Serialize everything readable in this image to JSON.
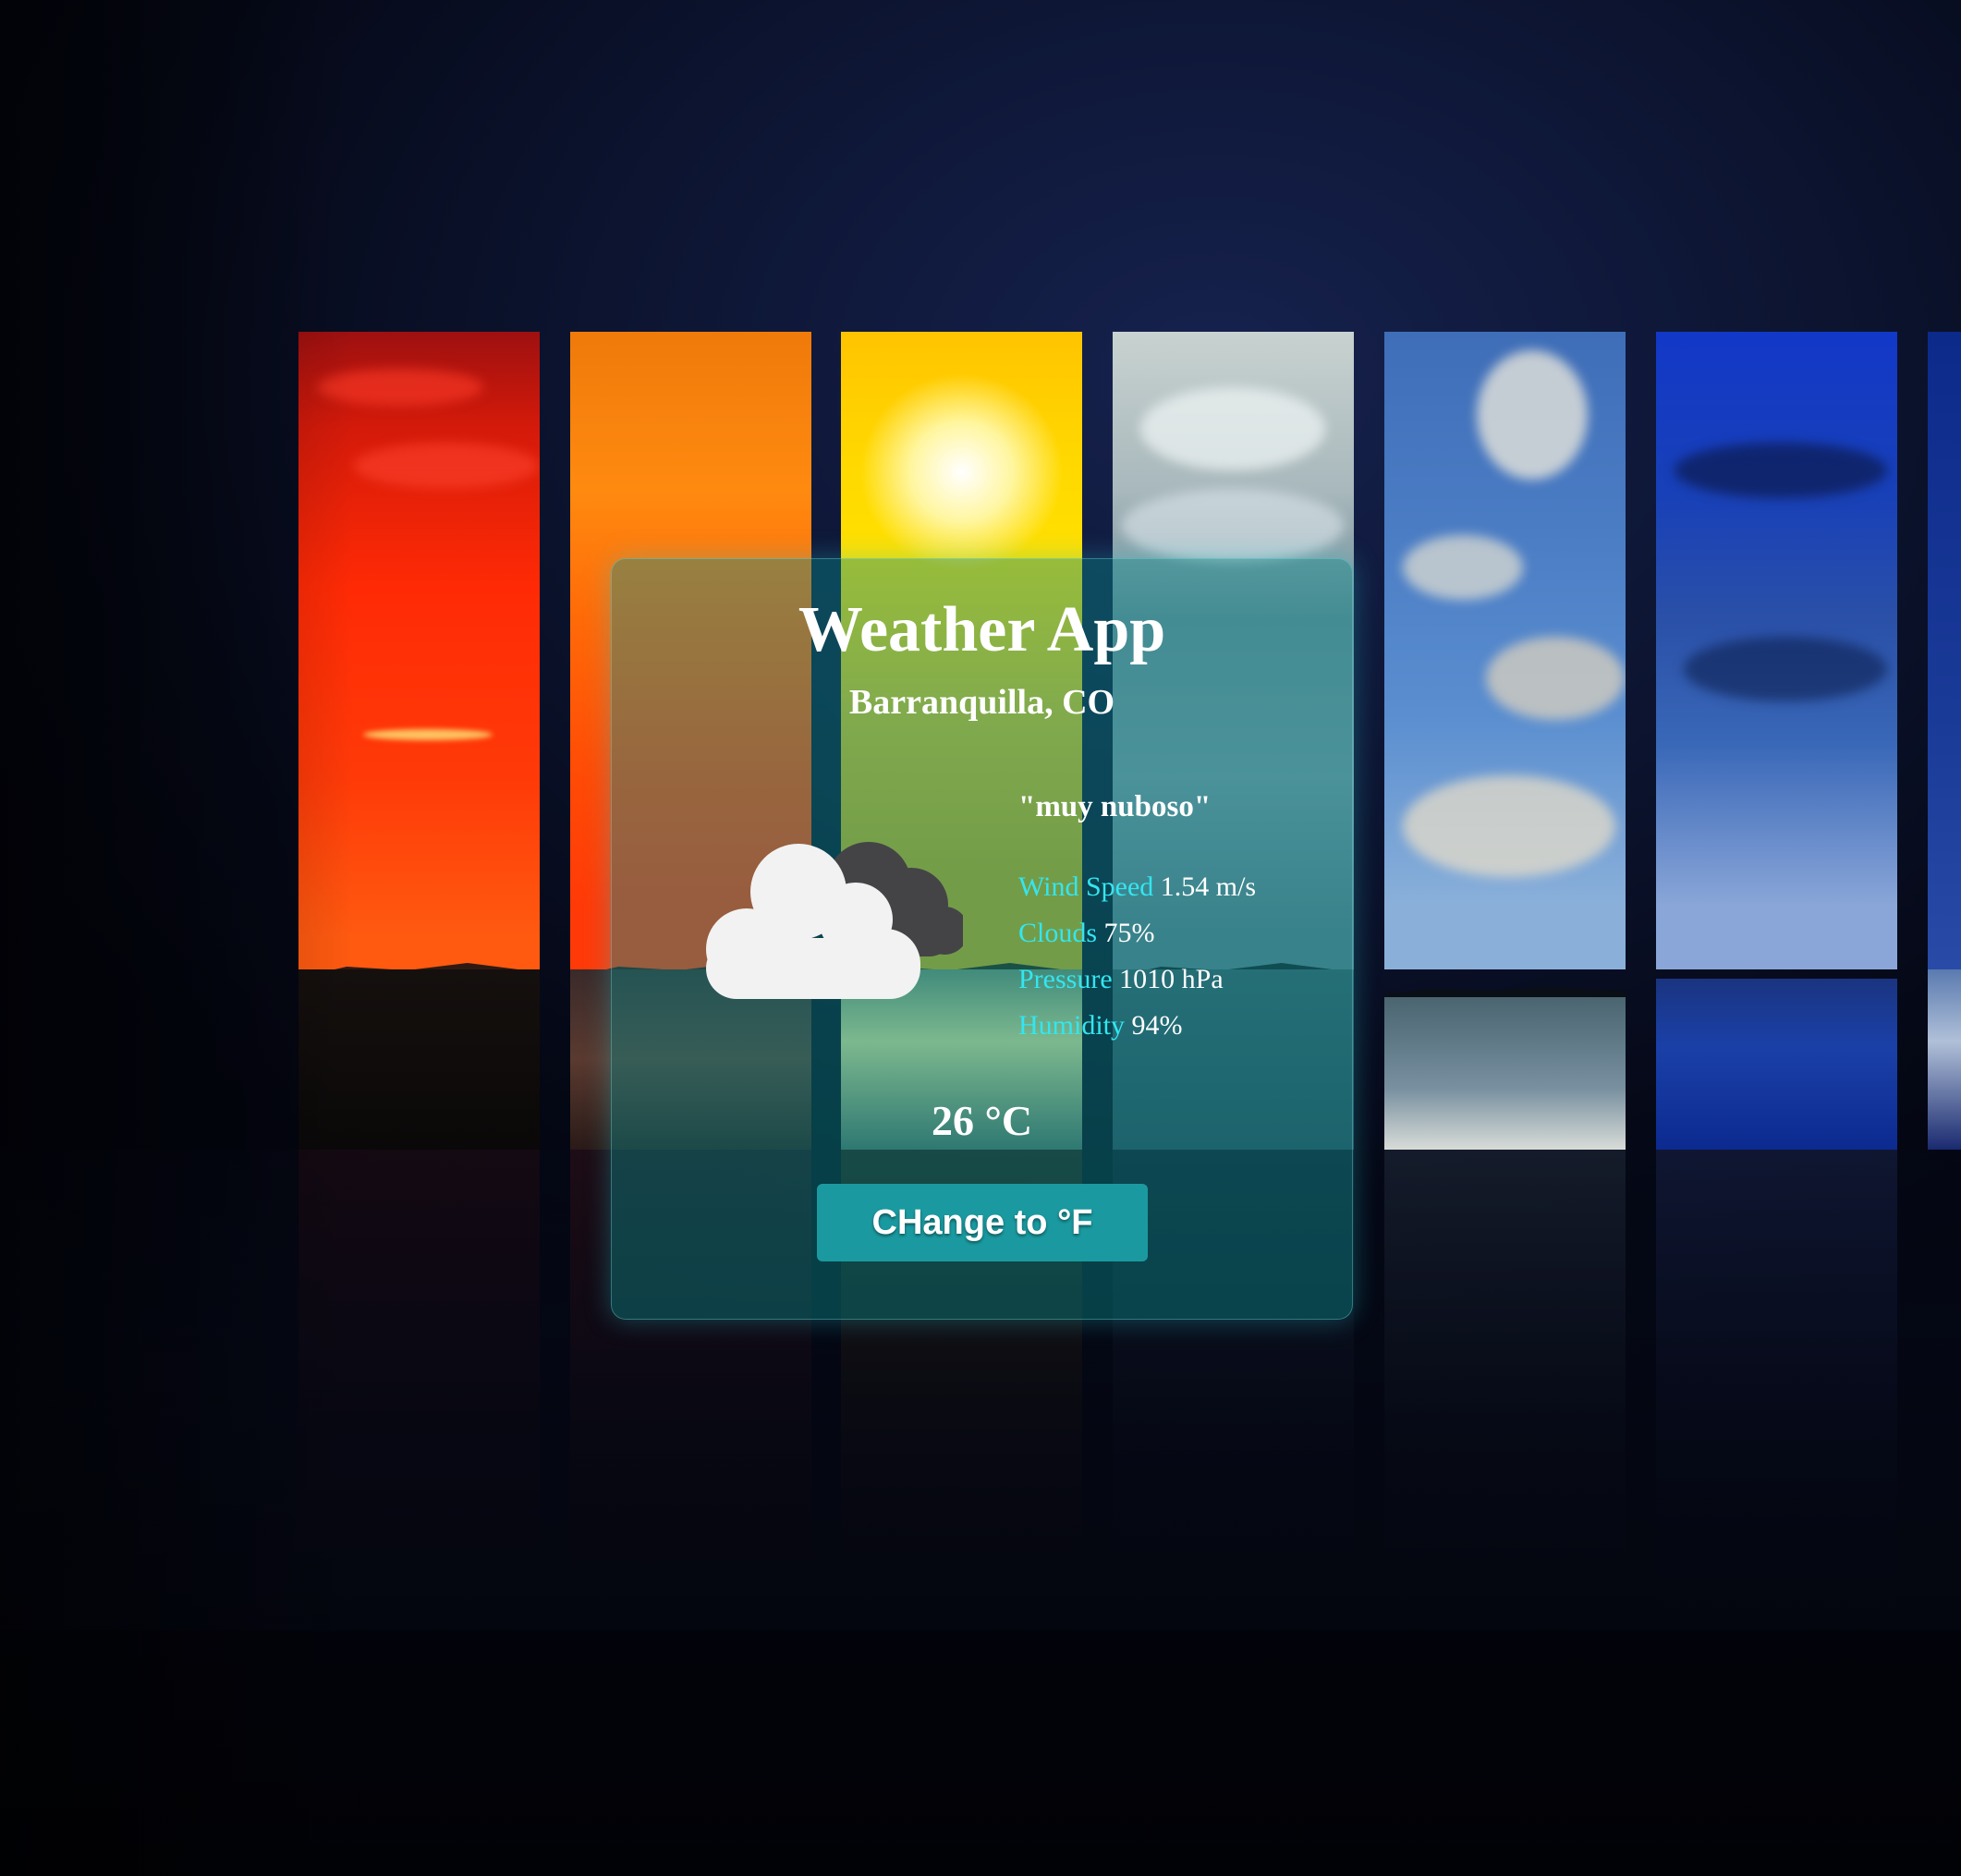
{
  "app": {
    "title": "Weather App",
    "location": "Barranquilla, CO"
  },
  "weather": {
    "description": "\"muy nuboso\"",
    "icon": "cloudy-icon",
    "temperature": "26 °C"
  },
  "stats": [
    {
      "label": "Wind Speed",
      "value": "1.54 m/s"
    },
    {
      "label": "Clouds",
      "value": "75%"
    },
    {
      "label": "Pressure",
      "value": "1010 hPa"
    },
    {
      "label": "Humidity",
      "value": "94%"
    }
  ],
  "controls": {
    "toggle_unit_label": "CHange to °F"
  },
  "colors": {
    "card_tint": "#0a8c8c",
    "label_accent": "#33e6f0",
    "button_bg": "#1a9aa0",
    "background": "#0c1430"
  }
}
